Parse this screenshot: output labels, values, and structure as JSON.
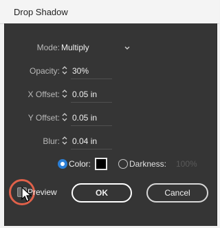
{
  "dialog": {
    "title": "Drop Shadow"
  },
  "fields": {
    "mode": {
      "label": "Mode:",
      "value": "Multiply"
    },
    "opacity": {
      "label": "Opacity:",
      "value": "30%"
    },
    "x_offset": {
      "label": "X Offset:",
      "value": "0.05 in"
    },
    "y_offset": {
      "label": "Y Offset:",
      "value": "0.05 in"
    },
    "blur": {
      "label": "Blur:",
      "value": "0.04 in"
    }
  },
  "color_option": {
    "label": "Color:",
    "selected": true,
    "swatch": "#000000"
  },
  "darkness_option": {
    "label": "Darkness:",
    "value": "100%",
    "selected": false
  },
  "preview": {
    "label": "Preview",
    "checked": true
  },
  "buttons": {
    "ok": "OK",
    "cancel": "Cancel"
  },
  "colors": {
    "panel_bg": "#353535",
    "accent": "#2b7fd6",
    "focus_ring": "#e0614a"
  }
}
